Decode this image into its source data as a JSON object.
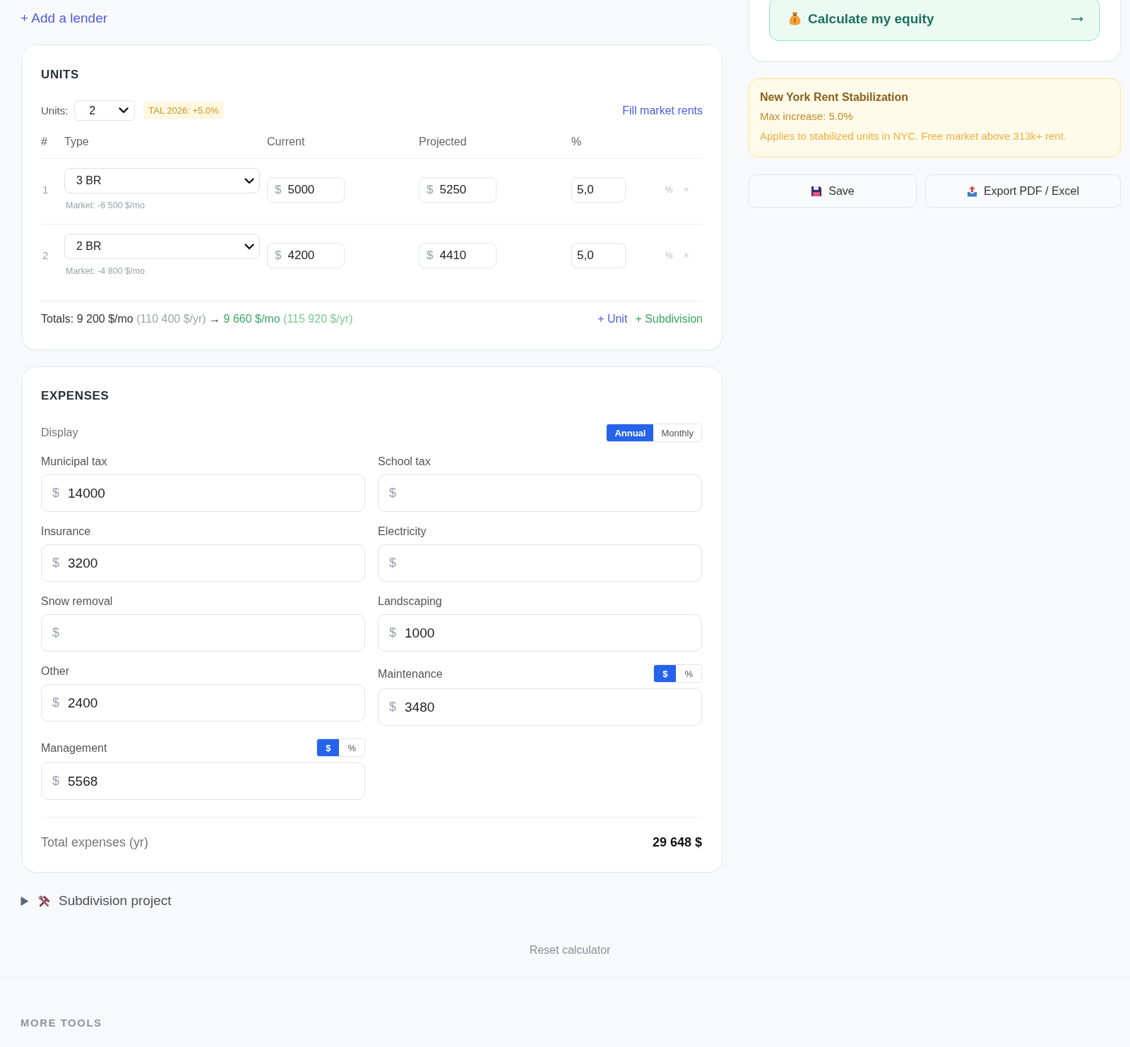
{
  "lenders": {
    "add_link": "+ Add a lender"
  },
  "units": {
    "title": "UNITS",
    "count_label": "Units:",
    "count": "2",
    "rate_badge": "TAL 2026: +5.0%",
    "fill_link": "Fill market rents",
    "columns": [
      "#",
      "Type",
      "Current",
      "Projected",
      "%"
    ],
    "rows": [
      {
        "number": "1",
        "type": "3 BR",
        "market": "Market: -6 500 $/mo",
        "current": {
          "prefix": "$",
          "value": "5000"
        },
        "projected": {
          "prefix": "$",
          "value": "5250"
        },
        "percent": "5,0",
        "percent_sign": "%",
        "remove": "×"
      },
      {
        "number": "2",
        "type": "2 BR",
        "market": "Market: -4 800 $/mo",
        "current": {
          "prefix": "$",
          "value": "4200"
        },
        "projected": {
          "prefix": "$",
          "value": "4410"
        },
        "percent": "5,0",
        "percent_sign": "%",
        "remove": "×"
      }
    ],
    "totals": {
      "current": "Totals: 9 200 $/mo",
      "current_annual": "(110 400 $/yr)",
      "arrow": "→",
      "projected": "9 660 $/mo",
      "projected_annual": "(115 920 $/yr)"
    },
    "add_unit": "+ Unit",
    "add_subdivision": "+ Subdivision"
  },
  "expenses": {
    "title": "EXPENSES",
    "display_label": "Display",
    "display_options": [
      {
        "label": "Annual",
        "selected": true
      },
      {
        "label": "Monthly",
        "selected": false
      }
    ],
    "fields": [
      {
        "label": "Municipal tax",
        "prefix": "$",
        "value": "14000"
      },
      {
        "label": "School tax",
        "prefix": "$"
      },
      {
        "label": "Insurance",
        "prefix": "$",
        "value": "3200"
      },
      {
        "label": "Electricity",
        "prefix": "$"
      },
      {
        "label": "Snow removal",
        "prefix": "$"
      },
      {
        "label": "Landscaping",
        "prefix": "$",
        "value": "1000"
      },
      {
        "label": "Other",
        "prefix": "$",
        "value": "2400"
      },
      {
        "label": "Maintenance",
        "prefix": "$",
        "value": "3480",
        "modes": [
          {
            "label": "$",
            "selected": true
          },
          {
            "label": "%",
            "selected": false
          }
        ]
      },
      {
        "label": "Management",
        "prefix": "$",
        "value": "5568",
        "modes": [
          {
            "label": "$",
            "selected": true
          },
          {
            "label": "%",
            "selected": false
          }
        ]
      }
    ],
    "total_label": "Total expenses (yr)",
    "total": "29 648 $"
  },
  "subdivision": {
    "title": "Subdivision project",
    "expanded": false
  },
  "reset": "Reset calculator",
  "equity": {
    "label": "Calculate my equity"
  },
  "notice": {
    "title": "New York Rent Stabilization",
    "limit": "Max increase: 5.0%",
    "note": "Applies to stabilized units in NYC. Free market above 313k+ rent."
  },
  "actions": [
    {
      "kind": "save",
      "label": "Save"
    },
    {
      "kind": "export",
      "label": "Export PDF / Excel"
    }
  ],
  "more_tools": {
    "title": "MORE TOOLS"
  }
}
